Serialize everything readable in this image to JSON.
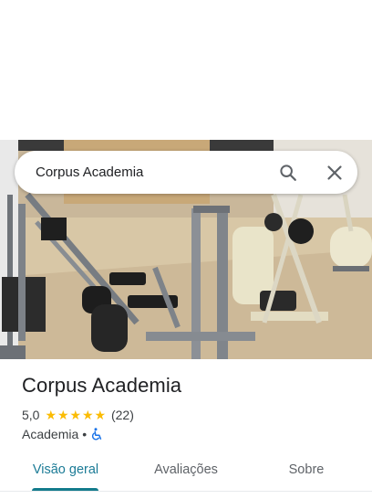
{
  "search": {
    "query": "Corpus Academia",
    "search_icon": "search-icon",
    "close_icon": "close-icon"
  },
  "photo": {
    "description_icon": "gym-photo"
  },
  "place": {
    "name": "Corpus Academia",
    "rating": "5,0",
    "stars": 5,
    "review_count": "(22)",
    "category": "Academia",
    "separator": "•",
    "accessibility_icon": "wheelchair-icon"
  },
  "tabs": [
    {
      "label": "Visão geral",
      "active": true
    },
    {
      "label": "Avaliações",
      "active": false
    },
    {
      "label": "Sobre",
      "active": false
    }
  ],
  "colors": {
    "star": "#fbbc04",
    "active_tab": "#137b8c",
    "accessibility": "#1a73e8"
  }
}
